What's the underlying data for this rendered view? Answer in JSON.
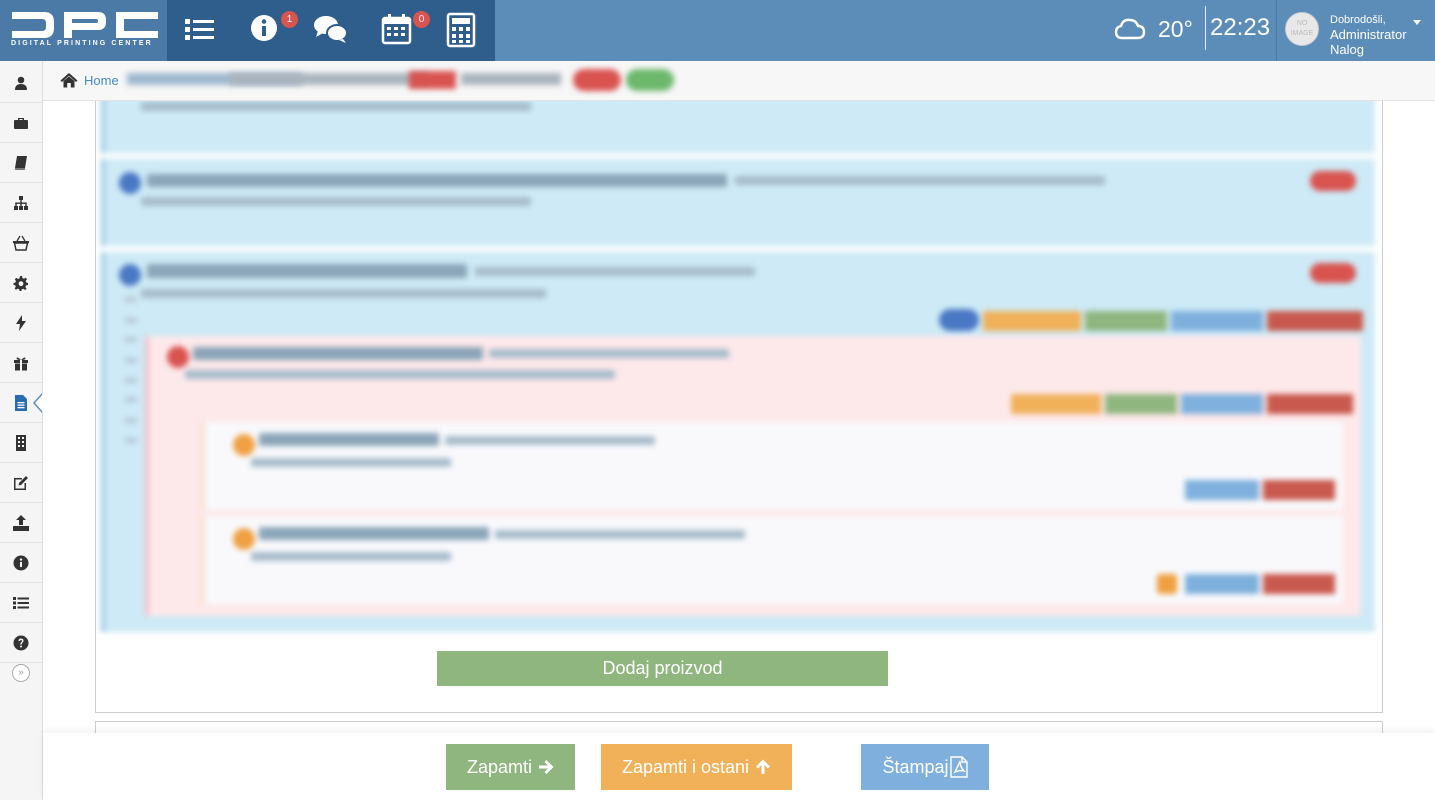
{
  "brand": {
    "logo_text": "DPC",
    "subtitle": "DIGITAL PRINTING CENTER"
  },
  "topbar": {
    "icons": [
      {
        "name": "list-icon"
      },
      {
        "name": "info-icon",
        "badge": "1"
      },
      {
        "name": "chat-icon"
      },
      {
        "name": "calendar-icon",
        "badge": "0"
      },
      {
        "name": "calculator-icon"
      }
    ],
    "weather": {
      "icon": "cloud-icon",
      "temperature": "20°"
    },
    "clock": "22:23",
    "user": {
      "avatar_text": "NO IMAGE",
      "greeting": "Dobrodošli,",
      "name": "Administrator",
      "role": "Nalog"
    }
  },
  "sidebar": {
    "items": [
      {
        "icon": "user-icon"
      },
      {
        "icon": "briefcase-icon"
      },
      {
        "icon": "book-icon"
      },
      {
        "icon": "sitemap-icon"
      },
      {
        "icon": "basket-icon"
      },
      {
        "icon": "gear-icon"
      },
      {
        "icon": "bolt-icon"
      },
      {
        "icon": "gift-icon"
      },
      {
        "icon": "document-icon",
        "active": true
      },
      {
        "icon": "building-icon"
      },
      {
        "icon": "edit-icon"
      },
      {
        "icon": "upload-icon"
      },
      {
        "icon": "info-circle-icon"
      },
      {
        "icon": "list-icon"
      },
      {
        "icon": "question-icon"
      }
    ],
    "collapse_label": "»"
  },
  "breadcrumb": {
    "home": "Home"
  },
  "main": {
    "add_product_label": "Dodaj proizvod"
  },
  "footer": {
    "save_label": "Zapamti",
    "save_stay_label": "Zapamti i ostani",
    "print_label": "Štampaj"
  },
  "colors": {
    "header": "#5b8db8",
    "header_dark": "#2f5e8c",
    "panel_blue": "#cdeaf6",
    "panel_pink": "#fde8ea",
    "save_green": "#8fb67f",
    "save_stay_orange": "#f0b159",
    "print_blue": "#7fb0dd"
  }
}
